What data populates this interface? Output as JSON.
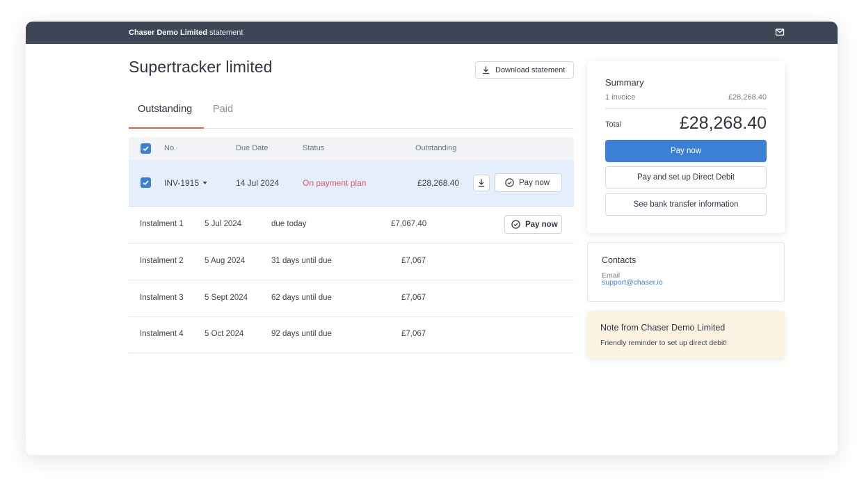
{
  "topbar": {
    "company": "Chaser Demo Limited",
    "suffix": " statement",
    "mail_icon": "mail-icon"
  },
  "page": {
    "title": "Supertracker limited",
    "download_label": "Download statement"
  },
  "tabs": [
    {
      "label": "Outstanding",
      "active": true
    },
    {
      "label": "Paid",
      "active": false
    }
  ],
  "table": {
    "headers": {
      "no": "No.",
      "due_date": "Due Date",
      "status": "Status",
      "outstanding": "Outstanding"
    },
    "invoice": {
      "number": "INV-1915",
      "due_date": "14 Jul 2024",
      "status": "On payment plan",
      "status_color": "#e0556a",
      "outstanding": "£28,268.40",
      "pay_label": "Pay now"
    },
    "instalments": [
      {
        "name": "Instalment 1",
        "date": "5 Jul 2024",
        "status": "due today",
        "amount": "£7,067.40",
        "pay_label": "Pay now"
      },
      {
        "name": "Instalment 2",
        "date": "5 Aug 2024",
        "status": "31 days until due",
        "amount": "£7,067"
      },
      {
        "name": "Instalment 3",
        "date": "5 Sept 2024",
        "status": "62 days until due",
        "amount": "£7,067"
      },
      {
        "name": "Instalment 4",
        "date": "5 Oct 2024",
        "status": "92 days until due",
        "amount": "£7,067"
      }
    ]
  },
  "summary": {
    "title": "Summary",
    "count_label": "1 invoice",
    "count_amount": "£28,268.40",
    "total_label": "Total",
    "total": "£28,268.40",
    "pay_now": "Pay now",
    "direct_debit": "Pay and set up Direct Debit",
    "bank_transfer": "See bank transfer information"
  },
  "contacts": {
    "title": "Contacts",
    "email_label": "Email",
    "email": "support@chaser.io"
  },
  "note": {
    "title": "Note from Chaser Demo Limited",
    "body": "Friendly reminder to set up direct debit!"
  },
  "colors": {
    "topbar": "#3c4657",
    "accent_blue": "#3b7fd7",
    "tab_underline": "#e5613f",
    "selected_row": "#e5effb",
    "note_bg": "#fdf3e3"
  }
}
